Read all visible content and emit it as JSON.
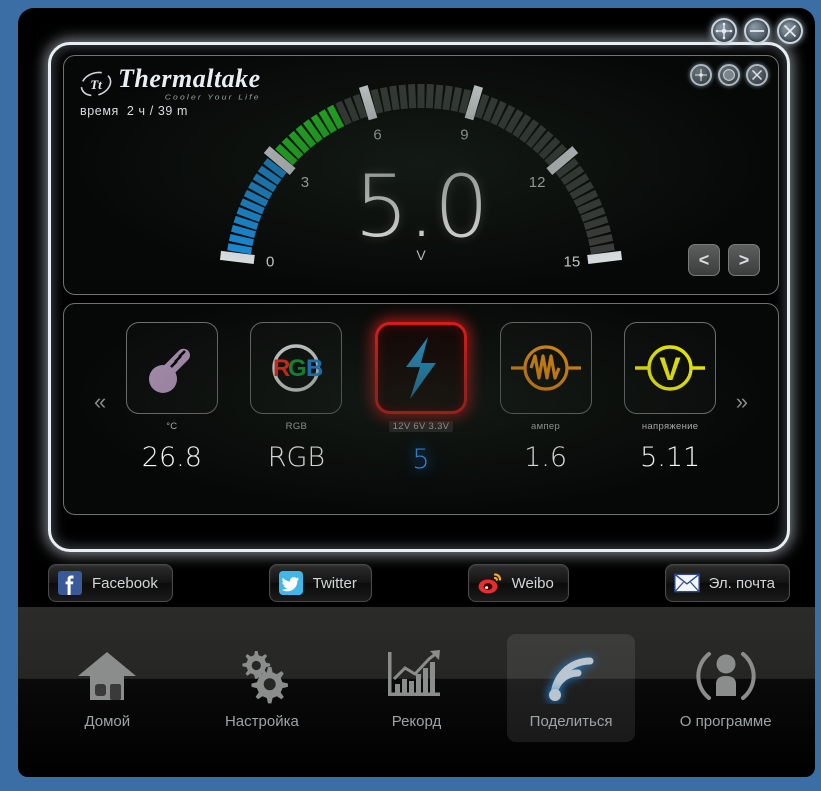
{
  "window": {
    "controls": [
      {
        "name": "move-button",
        "icon": "move-icon"
      },
      {
        "name": "minimize-button",
        "icon": "minimize-icon"
      },
      {
        "name": "close-button",
        "icon": "close-icon"
      }
    ]
  },
  "panel": {
    "controls": [
      {
        "name": "panel-move-button",
        "icon": "move-icon"
      },
      {
        "name": "panel-restore-button",
        "icon": "circle-icon"
      },
      {
        "name": "panel-close-button",
        "icon": "close-icon"
      }
    ]
  },
  "brand": {
    "name": "Thermaltake",
    "tagline": "Cooler Your Life"
  },
  "status": {
    "time_label": "время",
    "time_value": "2 ч / 39 m"
  },
  "gauge": {
    "value": "5.0",
    "unit": "V",
    "ticks": [
      "0",
      "3",
      "6",
      "9",
      "12",
      "15"
    ],
    "min": 0,
    "max": 15,
    "current": 5.0,
    "blue_until": 3,
    "green_until": 5,
    "color_blue": "#1a90e0",
    "color_green": "#22cc22",
    "prev_label": "<",
    "next_label": ">"
  },
  "strip": {
    "prev_label": "«",
    "next_label": "»",
    "cells": [
      {
        "icon": "thermometer-icon",
        "label": "°C",
        "value": "26.8",
        "selected": false,
        "color": "#b094b8"
      },
      {
        "icon": "rgb-circle-icon",
        "label": "RGB",
        "value": "RGB",
        "selected": false,
        "color": "#ffffff"
      },
      {
        "icon": "lightning-bolt-icon",
        "label": "12V 6V 3.3V",
        "value": "5",
        "selected": true,
        "color": "#29a8e8"
      },
      {
        "icon": "resistor-circle-icon",
        "label": "ампер",
        "value": "1.6",
        "selected": false,
        "color": "#ff9a10"
      },
      {
        "icon": "voltmeter-icon",
        "label": "напряжение",
        "value": "5.11",
        "selected": false,
        "color": "#f2f20a"
      }
    ]
  },
  "social": [
    {
      "icon": "facebook-icon",
      "label": "Facebook"
    },
    {
      "icon": "twitter-icon",
      "label": "Twitter"
    },
    {
      "icon": "weibo-icon",
      "label": "Weibo"
    },
    {
      "icon": "email-icon",
      "label": "Эл. почта"
    }
  ],
  "nav": [
    {
      "icon": "home-icon",
      "label": "Домой",
      "active": false
    },
    {
      "icon": "gears-icon",
      "label": "Настройка",
      "active": false
    },
    {
      "icon": "chart-icon",
      "label": "Рекорд",
      "active": false
    },
    {
      "icon": "rss-share-icon",
      "label": "Поделиться",
      "active": true
    },
    {
      "icon": "about-person-icon",
      "label": "О программе",
      "active": false
    }
  ]
}
